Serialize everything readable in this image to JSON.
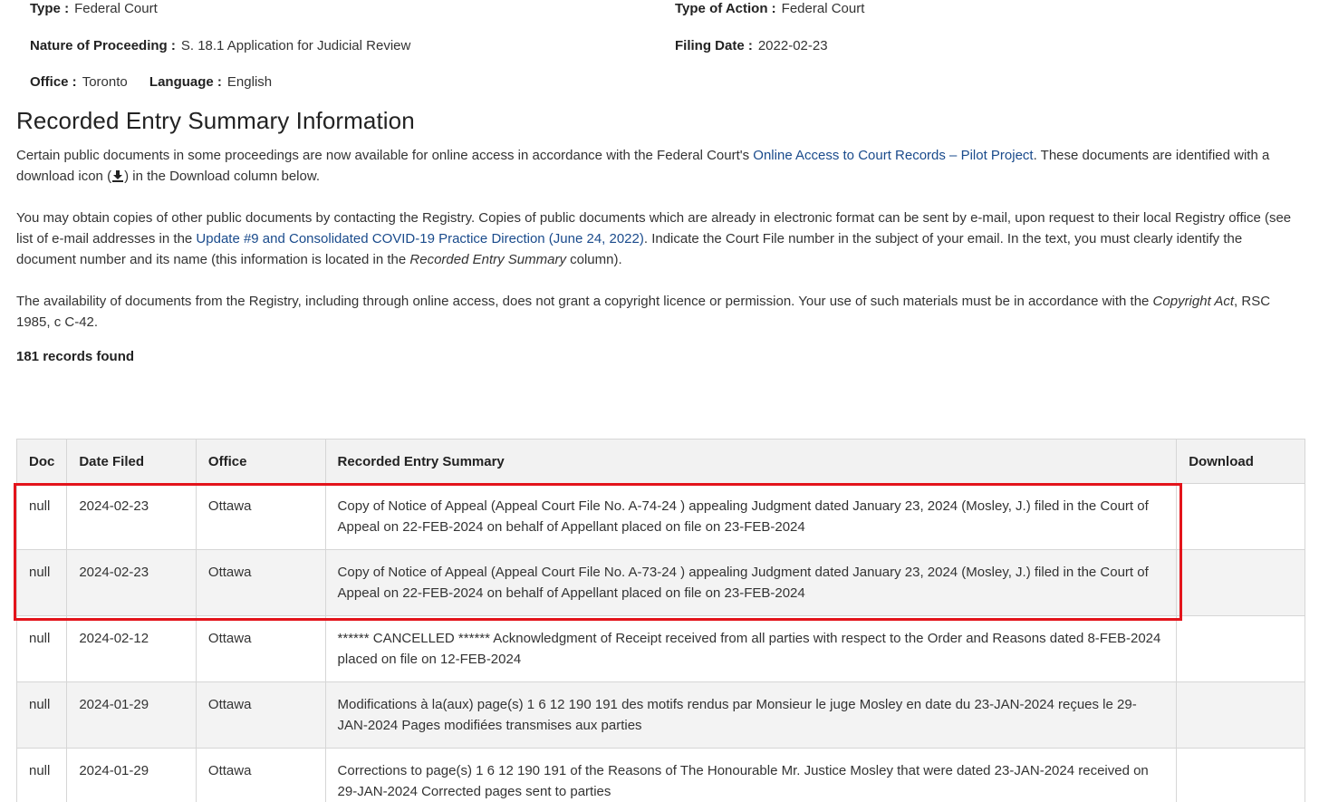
{
  "meta": {
    "type_label": "Type :",
    "type_value": "Federal Court",
    "type_of_action_label": "Type of Action :",
    "type_of_action_value": "Federal Court",
    "nature_label": "Nature of Proceeding :",
    "nature_value": "S. 18.1 Application for Judicial Review",
    "filing_date_label": "Filing Date :",
    "filing_date_value": "2022-02-23",
    "office_label": "Office :",
    "office_value": "Toronto",
    "language_label": "Language :",
    "language_value": "English"
  },
  "section": {
    "title": "Recorded Entry Summary Information",
    "para1_a": "Certain public documents in some proceedings are now available for online access in accordance with the Federal Court's ",
    "para1_link": "Online Access to Court Records – Pilot Project",
    "para1_b": ". These documents are identified with a download icon (",
    "para1_c": ") in the Download column below.",
    "para2_a": "You may obtain copies of other public documents by contacting the Registry. Copies of public documents which are already in electronic format can be sent by e-mail, upon request to their local Registry office (see list of e-mail addresses in the ",
    "para2_link": "Update #9 and Consolidated COVID-19 Practice Direction (June 24, 2022)",
    "para2_b": ". Indicate the Court File number in the subject of your email. In the text, you must clearly identify the document number and its name (this information is located in the ",
    "para2_em": "Recorded Entry Summary",
    "para2_c": " column).",
    "para3_a": "The availability of documents from the Registry, including through online access, does not grant a copyright licence or permission. Your use of such materials must be in accordance with the ",
    "para3_em": "Copyright Act",
    "para3_b": ", RSC 1985, c C-42.",
    "records_found": "181 records found"
  },
  "table": {
    "headers": {
      "doc": "Doc",
      "date_filed": "Date Filed",
      "office": "Office",
      "summary": "Recorded Entry Summary",
      "download": "Download"
    },
    "rows": [
      {
        "doc": "null",
        "date": "2024-02-23",
        "office": "Ottawa",
        "summary": "Copy of Notice of Appeal (Appeal Court File No. A-74-24 ) appealing Judgment dated January 23, 2024 (Mosley, J.) filed in the Court of Appeal on 22-FEB-2024 on behalf of Appellant placed on file on 23-FEB-2024",
        "download": ""
      },
      {
        "doc": "null",
        "date": "2024-02-23",
        "office": "Ottawa",
        "summary": "Copy of Notice of Appeal (Appeal Court File No. A-73-24 ) appealing Judgment dated January 23, 2024 (Mosley, J.) filed in the Court of Appeal on 22-FEB-2024 on behalf of Appellant placed on file on 23-FEB-2024",
        "download": ""
      },
      {
        "doc": "null",
        "date": "2024-02-12",
        "office": "Ottawa",
        "summary": "****** CANCELLED ****** Acknowledgment of Receipt received from all parties with respect to the Order and Reasons dated 8-FEB-2024 placed on file on 12-FEB-2024",
        "download": ""
      },
      {
        "doc": "null",
        "date": "2024-01-29",
        "office": "Ottawa",
        "summary": "Modifications à la(aux) page(s) 1 6 12 190 191 des motifs rendus par Monsieur le juge Mosley en date du 23-JAN-2024 reçues le 29-JAN-2024 Pages modifiées transmises aux parties",
        "download": ""
      },
      {
        "doc": "null",
        "date": "2024-01-29",
        "office": "Ottawa",
        "summary": "Corrections to page(s) 1 6 12 190 191 of the Reasons of The Honourable Mr. Justice Mosley that were dated 23-JAN-2024 received on 29-JAN-2024 Corrected pages sent to parties",
        "download": ""
      }
    ]
  },
  "icons": {
    "download_inline": "download-icon"
  },
  "colors": {
    "link": "#1a4b8c",
    "highlight": "#e3141b",
    "header_bg": "#f2f2f2",
    "alt_row_bg": "#f3f3f3"
  }
}
